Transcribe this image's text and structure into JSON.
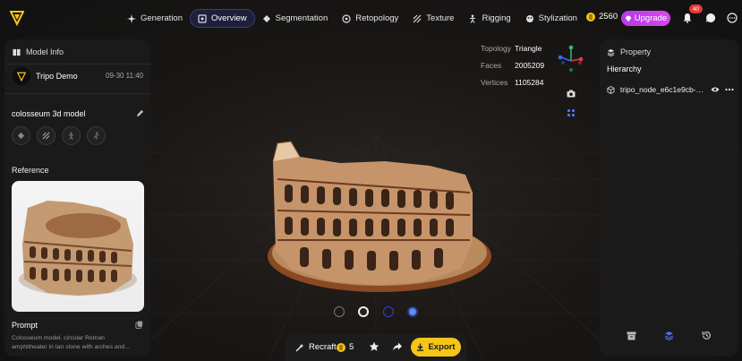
{
  "nav": {
    "items": [
      {
        "label": "Generation",
        "icon": "sparkle-icon",
        "active": false
      },
      {
        "label": "Overview",
        "icon": "overview-icon",
        "active": true
      },
      {
        "label": "Segmentation",
        "icon": "segmentation-icon",
        "active": false
      },
      {
        "label": "Retopology",
        "icon": "retopology-icon",
        "active": false
      },
      {
        "label": "Texture",
        "icon": "texture-icon",
        "active": false
      },
      {
        "label": "Rigging",
        "icon": "rigging-icon",
        "active": false
      },
      {
        "label": "Stylization",
        "icon": "stylization-icon",
        "active": false
      }
    ],
    "credits": "2560",
    "upgrade_label": "Upgrade",
    "notification_count": "40"
  },
  "left_panel": {
    "header": "Model Info",
    "project_name": "Tripo Demo",
    "project_date": "09-30 11:40",
    "model_title": "colosseum 3d model",
    "reference_label": "Reference",
    "prompt_label": "Prompt",
    "prompt_text": "Colosseum model, circular Roman amphitheater in tan stone with arches and..."
  },
  "right_panel": {
    "header": "Property",
    "hierarchy_label": "Hierarchy",
    "node_name": "tripo_node_e6c1e9cb-fa..."
  },
  "stats": {
    "topology_label": "Topology",
    "topology_value": "Triangle",
    "faces_label": "Faces",
    "faces_value": "2005209",
    "vertices_label": "Vertices",
    "vertices_value": "1105284"
  },
  "action_bar": {
    "recraft_label": "Recraft",
    "recraft_cost": "5",
    "export_label": "Export"
  },
  "colors": {
    "accent": "#f5c518",
    "upgrade": "#c93fe9",
    "active_nav": "#1d1f3b"
  }
}
